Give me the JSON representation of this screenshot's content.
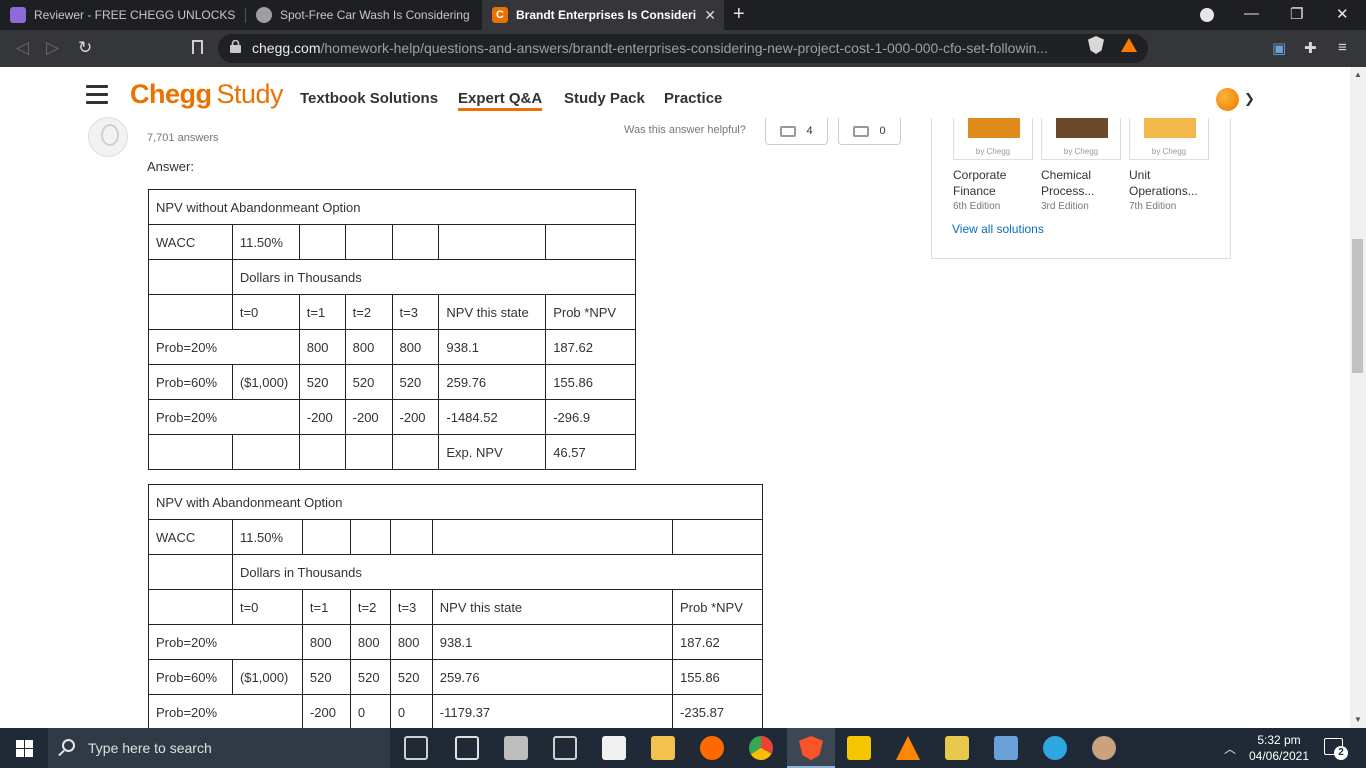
{
  "browser": {
    "tabs": [
      {
        "title": "Reviewer - FREE CHEGG UNLOCKS | Pa",
        "favicon_color": "#8c6bd6"
      },
      {
        "title": "Spot-Free Car Wash Is Considering A N",
        "favicon_color": "#9e9e9e"
      },
      {
        "title": "Brandt Enterprises Is Considering",
        "favicon_color": "#eb7100",
        "close": "✕"
      }
    ],
    "new_tab": "+",
    "window_controls": {
      "minimize": "—",
      "restore": "❐",
      "close": "✕"
    },
    "url_domain": "chegg.com",
    "url_path": "/homework-help/questions-and-answers/brandt-enterprises-considering-new-project-cost-1-000-000-cfo-set-followin..."
  },
  "site": {
    "logo_main": "Chegg",
    "logo_sub": "Study",
    "nav": [
      "Textbook Solutions",
      "Expert Q&A",
      "Study Pack",
      "Practice"
    ],
    "nav_active_index": 1,
    "brand_color": "#eb7100"
  },
  "answer": {
    "answers_count": "7,701 answers",
    "helpful_question": "Was this answer helpful?",
    "thumbs_up_count": "4",
    "thumbs_down_count": "0",
    "answer_label": "Answer:"
  },
  "table1": {
    "title": "NPV without Abandonmeant Option",
    "wacc_label": "WACC",
    "wacc_value": "11.50%",
    "units": "Dollars in Thousands",
    "headers": [
      "t=0",
      "t=1",
      "t=2",
      "t=3",
      "NPV this state",
      "Prob *NPV"
    ],
    "rows": [
      {
        "prob": "Prob=20%",
        "t0": "",
        "t1": "800",
        "t2": "800",
        "t3": "800",
        "npv": "938.1",
        "pnpv": "187.62"
      },
      {
        "prob": "Prob=60%",
        "t0": "($1,000)",
        "t1": "520",
        "t2": "520",
        "t3": "520",
        "npv": "259.76",
        "pnpv": "155.86"
      },
      {
        "prob": "Prob=20%",
        "t0": "",
        "t1": "-200",
        "t2": "-200",
        "t3": "-200",
        "npv": "-1484.52",
        "pnpv": "-296.9"
      }
    ],
    "exp_label": "Exp. NPV",
    "exp_value": "46.57"
  },
  "table2": {
    "title": "NPV with Abandonmeant Option",
    "wacc_label": "WACC",
    "wacc_value": "11.50%",
    "units": "Dollars in Thousands",
    "headers": [
      "t=0",
      "t=1",
      "t=2",
      "t=3",
      "NPV this state",
      "Prob *NPV"
    ],
    "rows": [
      {
        "prob": "Prob=20%",
        "t0": "",
        "t1": "800",
        "t2": "800",
        "t3": "800",
        "npv": "938.1",
        "pnpv": "187.62"
      },
      {
        "prob": "Prob=60%",
        "t0": "($1,000)",
        "t1": "520",
        "t2": "520",
        "t3": "520",
        "npv": "259.76",
        "pnpv": "155.86"
      },
      {
        "prob": "Prob=20%",
        "t0": "",
        "t1": "-200",
        "t2": "0",
        "t3": "0",
        "npv": "-1179.37",
        "pnpv": "-235.87"
      }
    ]
  },
  "sidebar": {
    "books": [
      {
        "by": "by Chegg",
        "title": "Corporate Finance",
        "edition": "6th Edition",
        "cover_color": "#e08a1e"
      },
      {
        "by": "by Chegg",
        "title": "Chemical Process...",
        "edition": "3rd Edition",
        "cover_color": "#6b4a2a"
      },
      {
        "by": "by Chegg",
        "title": "Unit Operations...",
        "edition": "7th Edition",
        "cover_color": "#f2b84b"
      }
    ],
    "view_all": "View all solutions"
  },
  "taskbar": {
    "search_placeholder": "Type here to search",
    "time": "5:32 pm",
    "date": "04/06/2021",
    "notification_count": "2",
    "app_icon_colors": [
      "#d0d0d0",
      "#e0e0e0",
      "#bdbdbd",
      "#d0d0d0",
      "#f0f0f0",
      "#f2c14e",
      "#ff6a00",
      "#4caf50",
      "#fb542b",
      "#f6c700",
      "#ff8800",
      "#e8c84a",
      "#6aa0d8",
      "#2ea7e0",
      "#c9a27e"
    ]
  }
}
